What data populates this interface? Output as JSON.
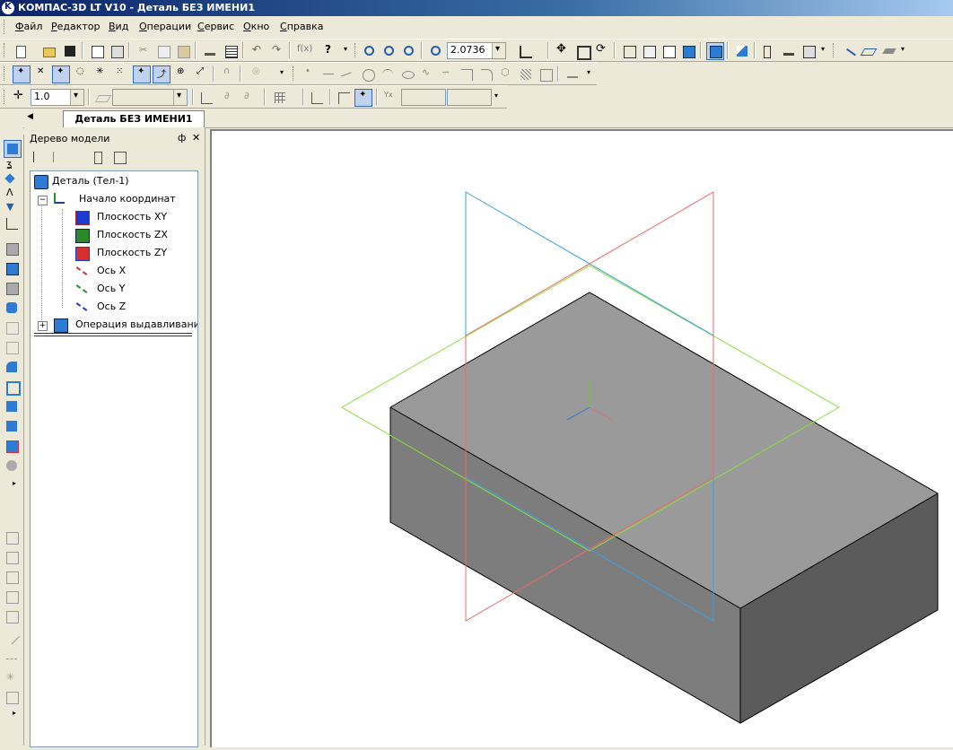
{
  "window": {
    "title": "КОМПАС-3D LT V10 - Деталь БЕЗ ИМЕНИ1"
  },
  "menu": [
    {
      "label": "Файл",
      "u": "Ф",
      "rest": "айл"
    },
    {
      "label": "Редактор",
      "u": "Р",
      "rest": "едактор"
    },
    {
      "label": "Вид",
      "u": "В",
      "rest": "ид"
    },
    {
      "label": "Операции",
      "u": "О",
      "rest": "перации"
    },
    {
      "label": "Сервис",
      "u": "С",
      "rest": "ервис"
    },
    {
      "label": "Окно",
      "u": "О",
      "rest": "кно"
    },
    {
      "label": "Справка",
      "u": "С",
      "rest": "правка"
    }
  ],
  "toolbar": {
    "zoom_value": "2.0736",
    "step_value": "1.0"
  },
  "tabs": {
    "active": "Деталь БЕЗ ИМЕНИ1"
  },
  "tree_panel": {
    "title": "Дерево модели",
    "pin_glyph": "ф",
    "close_glyph": "✕",
    "items": [
      {
        "label": "Деталь (Тел-1)"
      },
      {
        "label": "Начало координат"
      },
      {
        "label": "Плоскость XY"
      },
      {
        "label": "Плоскость ZX"
      },
      {
        "label": "Плоскость ZY"
      },
      {
        "label": "Ось X"
      },
      {
        "label": "Ось Y"
      },
      {
        "label": "Ось Z"
      },
      {
        "label": "Операция выдавливания:"
      }
    ]
  },
  "colors": {
    "plane_xy": "#3aa0e6",
    "plane_zx": "#88e03a",
    "plane_zy": "#ee6a6a",
    "box_top": "#9a9a9a",
    "box_left": "#7d7d7d",
    "box_right": "#5b5b5b",
    "selection": "#316ac5"
  }
}
